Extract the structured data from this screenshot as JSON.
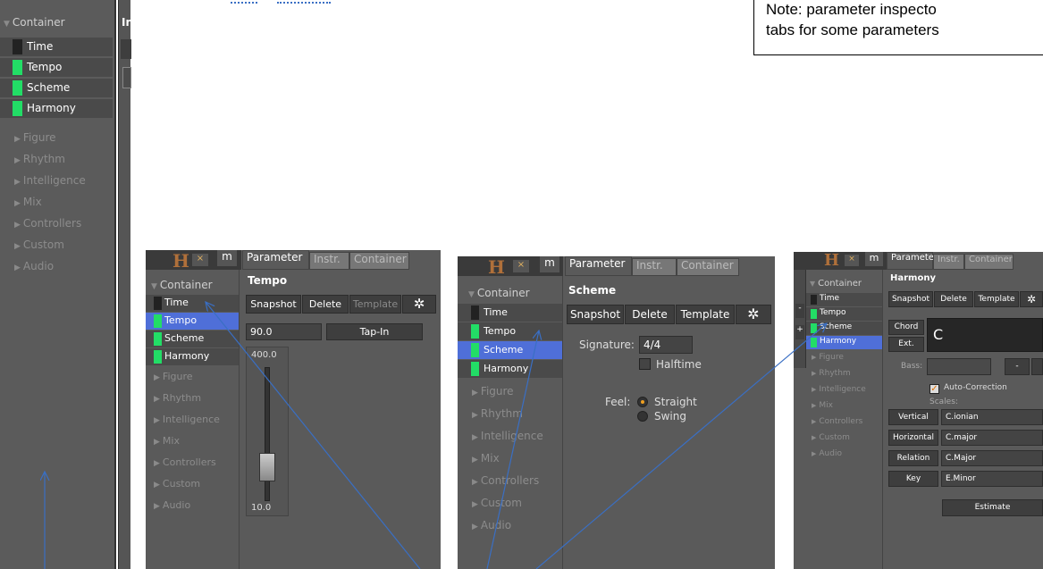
{
  "note": {
    "line1": "Note: parameter inspecto",
    "line2": "tabs for some parameters"
  },
  "left_panel": {
    "container_label": "Container",
    "items": [
      {
        "label": "Time",
        "swatch": "#222222"
      },
      {
        "label": "Tempo",
        "swatch": "#22dd66"
      },
      {
        "label": "Scheme",
        "swatch": "#22dd66"
      },
      {
        "label": "Harmony",
        "swatch": "#22dd66"
      }
    ],
    "categories": [
      "Figure",
      "Rhythm",
      "Intelligence",
      "Mix",
      "Controllers",
      "Custom",
      "Audio"
    ],
    "top_right_text": "In"
  },
  "tabs": {
    "parameter": "Parameter",
    "instr": "Instr.",
    "container": "Container"
  },
  "toolbar": {
    "snapshot": "Snapshot",
    "delete": "Delete",
    "template": "Template",
    "mode_m": "m",
    "logo": "H"
  },
  "panel1": {
    "title": "Tempo",
    "tempo_value": "90.0",
    "tap_in": "Tap-In",
    "slider_max": "400.0",
    "slider_min": "10.0",
    "selected": "Tempo"
  },
  "panel2": {
    "title": "Scheme",
    "signature_label": "Signature:",
    "signature_value": "4/4",
    "halftime_label": "Halftime",
    "feel_label": "Feel:",
    "feel_options": [
      "Straight",
      "Swing"
    ],
    "feel_selected": "Straight",
    "selected": "Scheme"
  },
  "panel3": {
    "title": "Harmony",
    "chord_button": "Chord",
    "ext_button": "Ext.",
    "chord_value": "C",
    "bass_label": "Bass:",
    "minus_button": "-",
    "auto_correction": "Auto-Correction",
    "auto_correction_checked": true,
    "scales_label": "Scales:",
    "rows": [
      {
        "button": "Vertical",
        "value": "C.ionian"
      },
      {
        "button": "Horizontal",
        "value": "C.major"
      },
      {
        "button": "Relation",
        "value": "C.Major"
      },
      {
        "button": "Key",
        "value": "E.Minor"
      }
    ],
    "estimate": "Estimate",
    "selected": "Harmony"
  },
  "colors": {
    "panel_bg": "#5a5a5a",
    "selected": "#4f6fd8",
    "swatch_green": "#22dd66",
    "arrow": "#3a6fc4"
  }
}
